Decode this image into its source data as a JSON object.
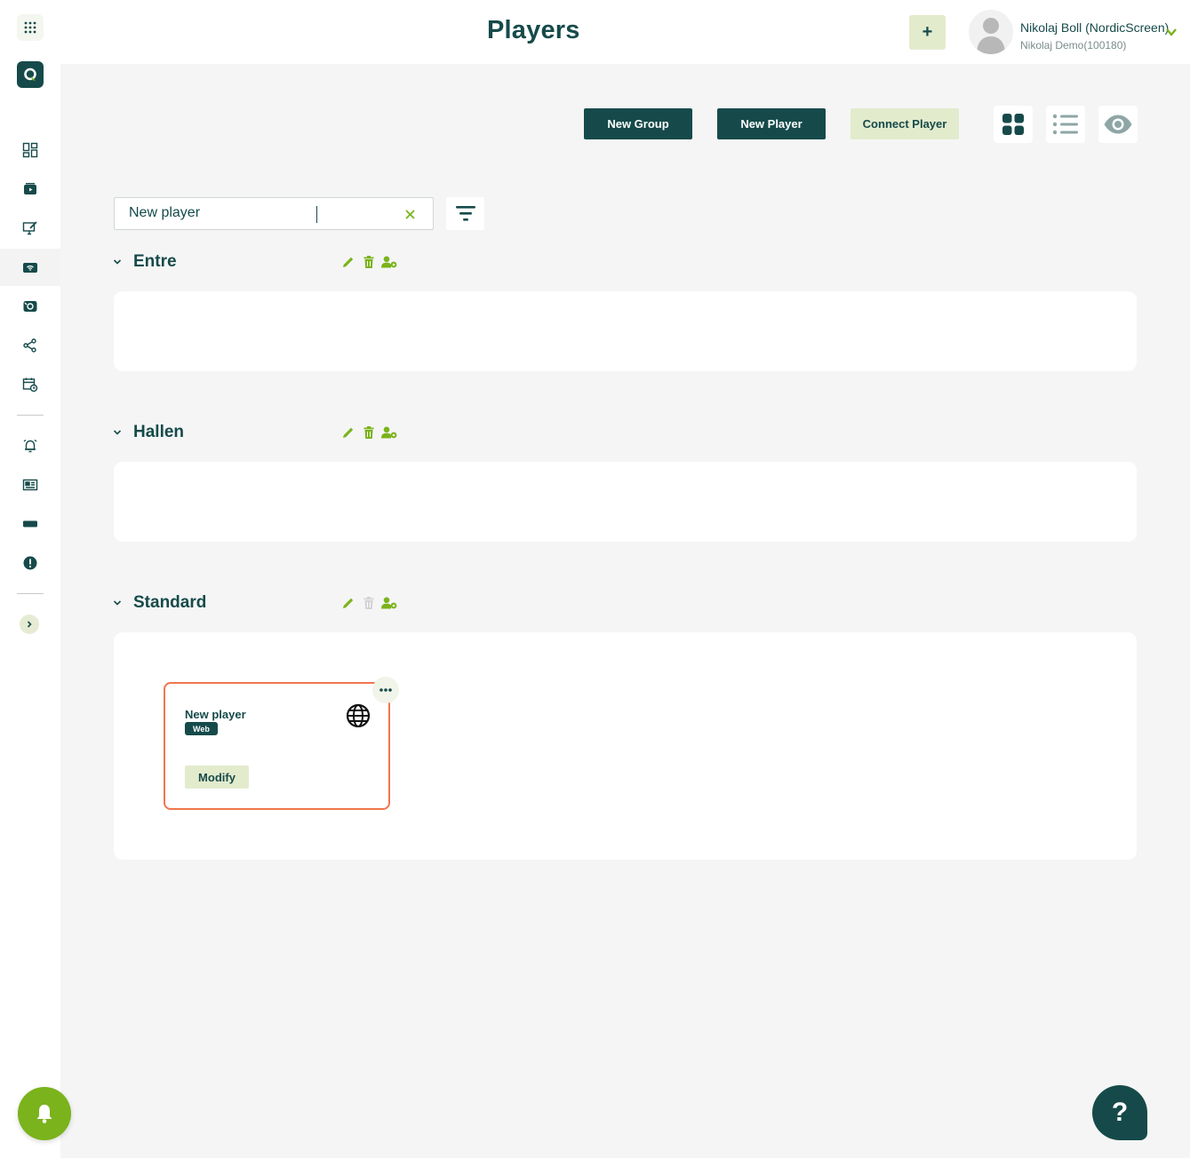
{
  "header": {
    "title": "Players",
    "add_label": "+",
    "user_name": "Nikolaj Boll (NordicScreen)",
    "user_org": "Nikolaj Demo(100180)"
  },
  "toolbar": {
    "new_group": "New Group",
    "new_player": "New Player",
    "connect_player": "Connect Player"
  },
  "search": {
    "value": "New player"
  },
  "groups": [
    {
      "title": "Entre"
    },
    {
      "title": "Hallen"
    },
    {
      "title": "Standard"
    }
  ],
  "player": {
    "name": "New player",
    "type": "Web",
    "modify_label": "Modify"
  },
  "help_label": "?",
  "colors": {
    "primary": "#164a4a",
    "accent": "#7ab31c",
    "light_accent": "#e3ebcd",
    "selection_border": "#f0764e",
    "background": "#f5f5f5"
  },
  "icons": {
    "sidebar": [
      "apps-grid-icon",
      "logo-icon",
      "dashboard-icon",
      "media-icon",
      "content-edit-icon",
      "players-icon",
      "screens-icon",
      "share-icon",
      "schedule-icon",
      "alarm-icon",
      "news-icon",
      "ticker-icon",
      "alert-icon",
      "expand-icon",
      "notifications-bell-icon"
    ],
    "group_actions": [
      "edit-pencil-icon",
      "delete-trash-icon",
      "user-settings-icon"
    ],
    "view_toggles": [
      "grid-view-icon",
      "list-view-icon",
      "preview-eye-icon"
    ]
  }
}
